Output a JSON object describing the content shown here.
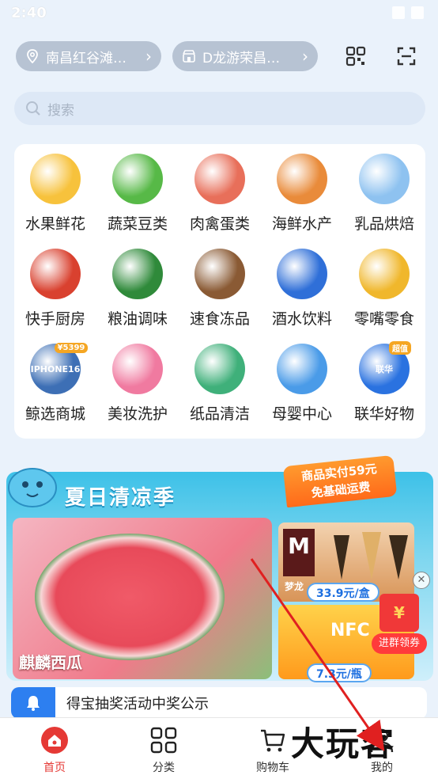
{
  "status_bar": {
    "time": "2:40"
  },
  "header": {
    "location_chip": "南昌红谷滩…",
    "store_chip": "D龙游荣昌…"
  },
  "search": {
    "placeholder": "搜索"
  },
  "categories": [
    {
      "label": "水果鲜花",
      "color": "#f7c23c"
    },
    {
      "label": "蔬菜豆类",
      "color": "#57b947"
    },
    {
      "label": "肉禽蛋类",
      "color": "#e86f5a"
    },
    {
      "label": "海鲜水产",
      "color": "#e98b3a"
    },
    {
      "label": "乳品烘焙",
      "color": "#8ec2f0"
    },
    {
      "label": "快手厨房",
      "color": "#d9412f"
    },
    {
      "label": "粮油调味",
      "color": "#2f8a3a"
    },
    {
      "label": "速食冻品",
      "color": "#8a5a34"
    },
    {
      "label": "酒水饮料",
      "color": "#2f6fd8"
    },
    {
      "label": "零嘴零食",
      "color": "#f0b72c"
    },
    {
      "label": "鲸选商城",
      "color": "#3d6fb5",
      "badge": "¥5399",
      "sub": "IPHONE16"
    },
    {
      "label": "美妆洗护",
      "color": "#f07aa0"
    },
    {
      "label": "纸品清洁",
      "color": "#3fb07a"
    },
    {
      "label": "母婴中心",
      "color": "#4a9be8"
    },
    {
      "label": "联华好物",
      "color": "#2a72e0",
      "badge": "超值",
      "sub": "联华"
    }
  ],
  "banner": {
    "title": "夏日清凉季",
    "promo_line1": "商品实付59元",
    "promo_line2": "免基础运费",
    "main_product": "麒麟西瓜",
    "side1_brand": "M",
    "side1_name": "梦龙",
    "side1_price": "33.9元/盒",
    "side2_brand": "NFC",
    "side2_price": "7.3元/瓶",
    "coupon_label": "进群领券"
  },
  "notice": {
    "text": "得宝抽奖活动中奖公示"
  },
  "tabs": [
    {
      "label": "首页"
    },
    {
      "label": "分类"
    },
    {
      "label": "购物车"
    },
    {
      "label": "我的"
    }
  ],
  "watermark": "大玩客",
  "colors": {
    "accent": "#e53935",
    "banner_blue": "#3dc1e8",
    "notice_blue": "#2d7ff0"
  }
}
